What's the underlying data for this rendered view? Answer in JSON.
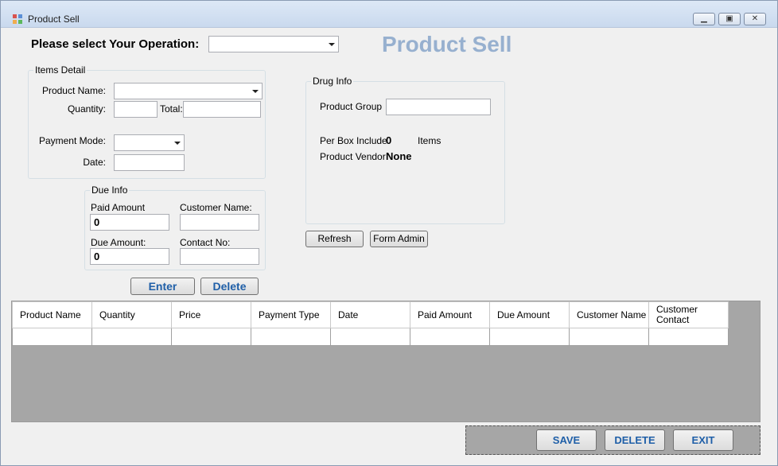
{
  "window": {
    "title": "Product Sell"
  },
  "operation": {
    "label": "Please select Your Operation:",
    "value": ""
  },
  "heading": "Product Sell",
  "items_detail": {
    "legend": "Items Detail",
    "product_name_label": "Product Name:",
    "product_name_value": "",
    "quantity_label": "Quantity:",
    "quantity_value": "",
    "total_label": "Total:",
    "total_value": "",
    "payment_mode_label": "Payment Mode:",
    "payment_mode_value": "",
    "date_label": "Date:",
    "date_value": ""
  },
  "due_info": {
    "legend": "Due Info",
    "paid_amount_label": "Paid Amount",
    "paid_amount_value": "0",
    "customer_name_label": "Customer Name:",
    "customer_name_value": "",
    "due_amount_label": "Due Amount:",
    "due_amount_value": "0",
    "contact_no_label": "Contact No:",
    "contact_no_value": ""
  },
  "drug_info": {
    "legend": "Drug Info",
    "product_group_label": "Product Group",
    "product_group_value": "",
    "per_box_label": "Per Box Include",
    "per_box_value": "0",
    "items_label": "Items",
    "vendor_label": "Product Vendor",
    "vendor_value": "None"
  },
  "buttons": {
    "refresh": "Refresh",
    "form_admin": "Form Admin",
    "enter": "Enter",
    "delete": "Delete",
    "save": "SAVE",
    "delete_bottom": "DELETE",
    "exit": "EXIT"
  },
  "grid": {
    "columns": [
      "Product Name",
      "Quantity",
      "Price",
      "Payment Type",
      "Date",
      "Paid Amount",
      "Due Amount",
      "Customer Name",
      "Customer Contact"
    ],
    "rows": [
      [
        "",
        "",
        "",
        "",
        "",
        "",
        "",
        "",
        ""
      ]
    ]
  },
  "colors": {
    "heading": "#97b0cf",
    "button_text": "#1f5fa8",
    "grid_background": "#a6a6a6"
  }
}
